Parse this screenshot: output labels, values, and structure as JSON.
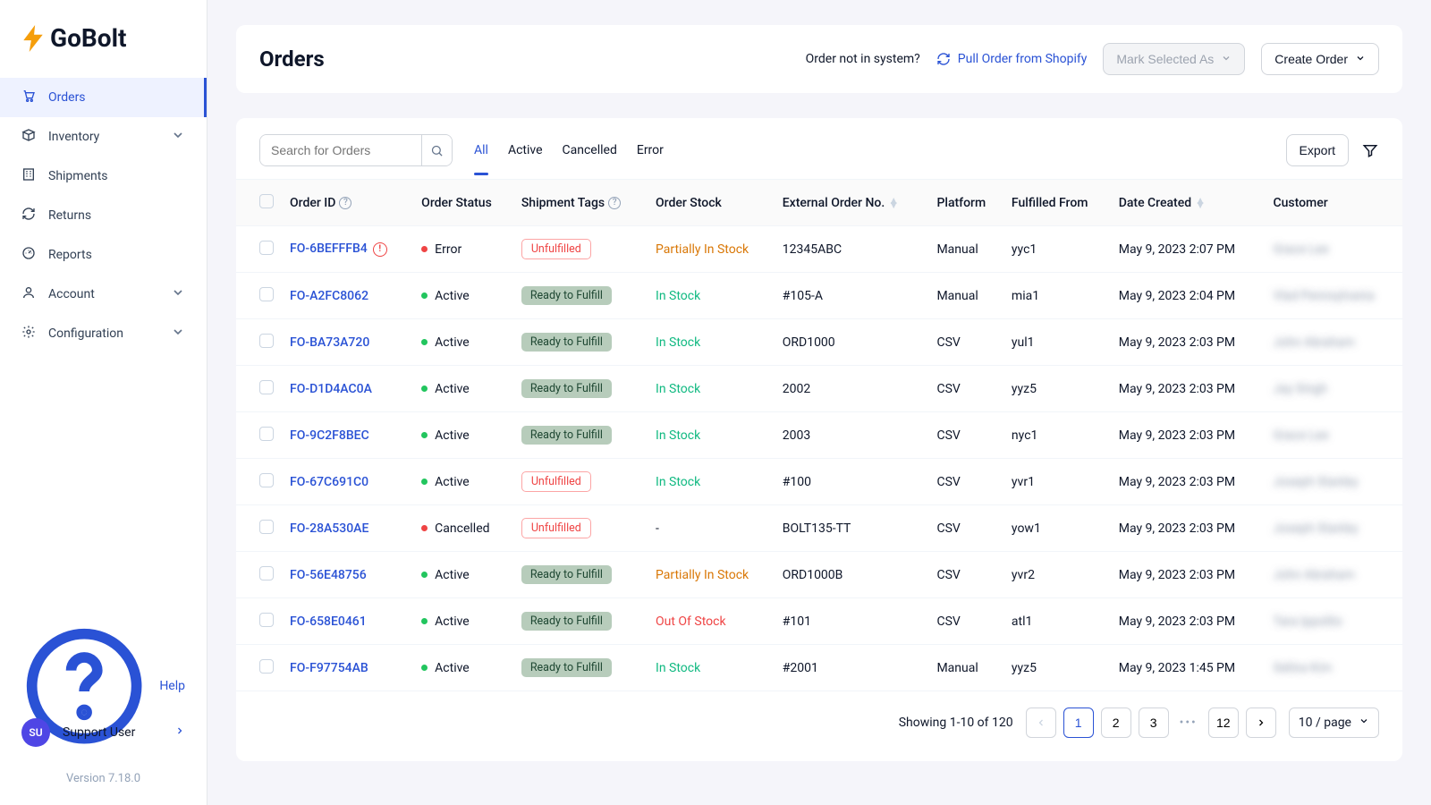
{
  "brand": "GoBolt",
  "nav": [
    {
      "label": "Orders",
      "icon": "cart",
      "active": true
    },
    {
      "label": "Inventory",
      "icon": "box",
      "expand": true
    },
    {
      "label": "Shipments",
      "icon": "building"
    },
    {
      "label": "Returns",
      "icon": "refresh"
    },
    {
      "label": "Reports",
      "icon": "gauge"
    },
    {
      "label": "Account",
      "icon": "user",
      "expand": true
    },
    {
      "label": "Configuration",
      "icon": "gear",
      "expand": true
    }
  ],
  "help_label": "Help",
  "user": {
    "initials": "SU",
    "name": "Support User"
  },
  "version": "Version 7.18.0",
  "page": {
    "title": "Orders",
    "not_in_system": "Order not in system?",
    "pull_link": "Pull Order from Shopify",
    "mark_selected": "Mark Selected As",
    "create_order": "Create Order"
  },
  "search_placeholder": "Search for Orders",
  "tabs": [
    "All",
    "Active",
    "Cancelled",
    "Error"
  ],
  "active_tab": 0,
  "export_label": "Export",
  "columns": [
    "Order ID",
    "Order Status",
    "Shipment Tags",
    "Order Stock",
    "External Order No.",
    "Platform",
    "Fulfilled From",
    "Date Created",
    "Customer"
  ],
  "rows": [
    {
      "id": "FO-6BEFFFB4",
      "err": true,
      "status": "Error",
      "dot": "red",
      "tag": "Unfulfilled",
      "tagType": "unf",
      "stock": "Partially In Stock",
      "stockType": "partial",
      "ext": "12345ABC",
      "platform": "Manual",
      "ff": "yyc1",
      "date": "May 9, 2023 2:07 PM",
      "cust": "Grace Lee"
    },
    {
      "id": "FO-A2FC8062",
      "status": "Active",
      "dot": "green",
      "tag": "Ready to Fulfill",
      "tagType": "rtf",
      "stock": "In Stock",
      "stockType": "in",
      "ext": "#105-A",
      "platform": "Manual",
      "ff": "mia1",
      "date": "May 9, 2023 2:04 PM",
      "cust": "Vlad Pennsylvania"
    },
    {
      "id": "FO-BA73A720",
      "status": "Active",
      "dot": "green",
      "tag": "Ready to Fulfill",
      "tagType": "rtf",
      "stock": "In Stock",
      "stockType": "in",
      "ext": "ORD1000",
      "platform": "CSV",
      "ff": "yul1",
      "date": "May 9, 2023 2:03 PM",
      "cust": "John Abraham"
    },
    {
      "id": "FO-D1D4AC0A",
      "status": "Active",
      "dot": "green",
      "tag": "Ready to Fulfill",
      "tagType": "rtf",
      "stock": "In Stock",
      "stockType": "in",
      "ext": "2002",
      "platform": "CSV",
      "ff": "yyz5",
      "date": "May 9, 2023 2:03 PM",
      "cust": "Jay Singh"
    },
    {
      "id": "FO-9C2F8BEC",
      "status": "Active",
      "dot": "green",
      "tag": "Ready to Fulfill",
      "tagType": "rtf",
      "stock": "In Stock",
      "stockType": "in",
      "ext": "2003",
      "platform": "CSV",
      "ff": "nyc1",
      "date": "May 9, 2023 2:03 PM",
      "cust": "Grace Lee"
    },
    {
      "id": "FO-67C691C0",
      "status": "Active",
      "dot": "green",
      "tag": "Unfulfilled",
      "tagType": "unf",
      "stock": "In Stock",
      "stockType": "in",
      "ext": "#100",
      "platform": "CSV",
      "ff": "yvr1",
      "date": "May 9, 2023 2:03 PM",
      "cust": "Joseph Stanley"
    },
    {
      "id": "FO-28A530AE",
      "status": "Cancelled",
      "dot": "red",
      "tag": "Unfulfilled",
      "tagType": "unf",
      "stock": "-",
      "stockType": "none",
      "ext": "BOLT135-TT",
      "platform": "CSV",
      "ff": "yow1",
      "date": "May 9, 2023 2:03 PM",
      "cust": "Joseph Stanley"
    },
    {
      "id": "FO-56E48756",
      "status": "Active",
      "dot": "green",
      "tag": "Ready to Fulfill",
      "tagType": "rtf",
      "stock": "Partially In Stock",
      "stockType": "partial",
      "ext": "ORD1000B",
      "platform": "CSV",
      "ff": "yvr2",
      "date": "May 9, 2023 2:03 PM",
      "cust": "John Abraham"
    },
    {
      "id": "FO-658E0461",
      "status": "Active",
      "dot": "green",
      "tag": "Ready to Fulfill",
      "tagType": "rtf",
      "stock": "Out Of Stock",
      "stockType": "out",
      "ext": "#101",
      "platform": "CSV",
      "ff": "atl1",
      "date": "May 9, 2023 2:03 PM",
      "cust": "Tara Ippolito"
    },
    {
      "id": "FO-F97754AB",
      "status": "Active",
      "dot": "green",
      "tag": "Ready to Fulfill",
      "tagType": "rtf",
      "stock": "In Stock",
      "stockType": "in",
      "ext": "#2001",
      "platform": "Manual",
      "ff": "yyz5",
      "date": "May 9, 2023 1:45 PM",
      "cust": "Selina Kim"
    }
  ],
  "pager": {
    "info": "Showing 1-10 of 120",
    "pages": [
      "1",
      "2",
      "3"
    ],
    "last": "12",
    "page_size": "10 / page"
  }
}
